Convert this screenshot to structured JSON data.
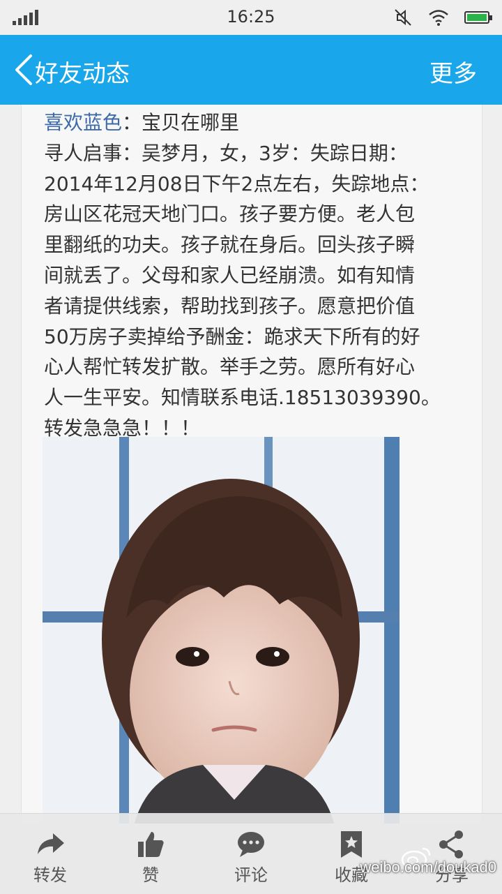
{
  "status_bar": {
    "time": "16:25",
    "icons": [
      "signal-icon",
      "mute-icon",
      "wifi-icon",
      "battery-icon"
    ]
  },
  "header": {
    "title": "好友动态",
    "more_label": "更多",
    "color": "#1aa6ea"
  },
  "post": {
    "author": "喜欢蓝色",
    "author_suffix": "：宝贝在哪里",
    "body": "寻人启事：吴梦月，女，3岁：失踪日期：\n2014年12月08日下午2点左右，失踪地点：\n房山区花冠天地门口。孩子要方便。老人包\n里翻纸的功夫。孩子就在身后。回头孩子瞬\n间就丢了。父母和家人已经崩溃。如有知情\n者请提供线索，帮助找到孩子。愿意把价值\n50万房子卖掉给予酬金：跪求天下所有的好\n心人帮忙转发扩散。举手之劳。愿所有好心\n人一生平安。知情联系电话.18513039390。\n转发急急急！！！",
    "author_color": "#3d6aa8"
  },
  "toolbar": {
    "items": [
      {
        "label": "转发",
        "icon": "share-arrow-icon"
      },
      {
        "label": "赞",
        "icon": "thumbs-up-icon"
      },
      {
        "label": "评论",
        "icon": "comment-icon"
      },
      {
        "label": "收藏",
        "icon": "bookmark-icon"
      },
      {
        "label": "分享",
        "icon": "share-icon"
      }
    ]
  },
  "watermark": {
    "text": "weibo.com/doukad0"
  }
}
